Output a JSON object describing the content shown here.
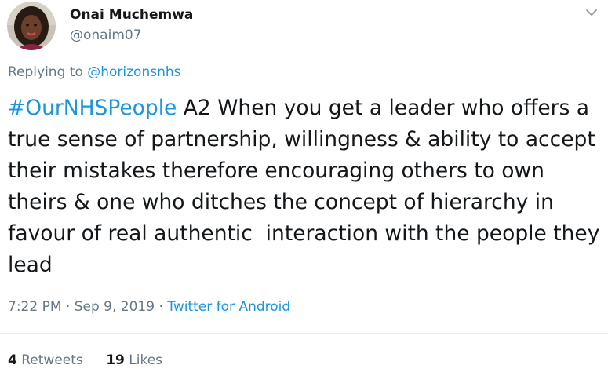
{
  "author": {
    "name": "Onai Muchemwa",
    "handle": "@onaim07"
  },
  "reply": {
    "prefix": "Replying to ",
    "mention": "@horizonsnhs"
  },
  "tweet": {
    "hashtag": "#OurNHSPeople",
    "text": " A2 When you get a leader who offers a true sense of partnership, willingness & ability to accept their mistakes therefore encouraging others to own theirs & one who ditches the concept of hierarchy in favour of real authentic  interaction with the people they lead"
  },
  "meta": {
    "time": "7:22 PM",
    "separator": " · ",
    "date": "Sep 9, 2019",
    "source": "Twitter for Android"
  },
  "stats": {
    "retweets_count": "4",
    "retweets_label": "Retweets",
    "likes_count": "19",
    "likes_label": "Likes"
  },
  "colors": {
    "link": "#1b95e0",
    "muted": "#657786",
    "text": "#14171a",
    "divider": "#e6ecf0"
  },
  "icons": {
    "caret": "chevron-down-icon",
    "avatar": "user-avatar"
  }
}
